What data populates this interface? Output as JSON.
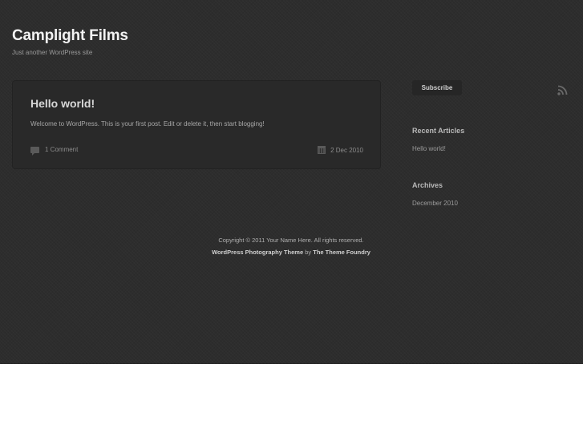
{
  "header": {
    "site_title": "Camplight Films",
    "tagline": "Just another WordPress site"
  },
  "post": {
    "title": "Hello world!",
    "excerpt": "Welcome to WordPress. This is your first post. Edit or delete it, then start blogging!",
    "comments": "1 Comment",
    "date": "2 Dec 2010"
  },
  "sidebar": {
    "subscribe_label": "Subscribe",
    "recent_title": "Recent Articles",
    "recent_items": [
      "Hello world!"
    ],
    "archives_title": "Archives",
    "archive_items": [
      "December 2010"
    ]
  },
  "footer": {
    "copyright": "Copyright © 2011  Your Name Here. All rights reserved.",
    "theme_link": "WordPress Photography Theme",
    "by_text": " by ",
    "author_link": "The Theme Foundry"
  },
  "colors": {
    "background": "#2d2d2d",
    "post_card": "#292929",
    "title_text": "#f2f2f2"
  }
}
